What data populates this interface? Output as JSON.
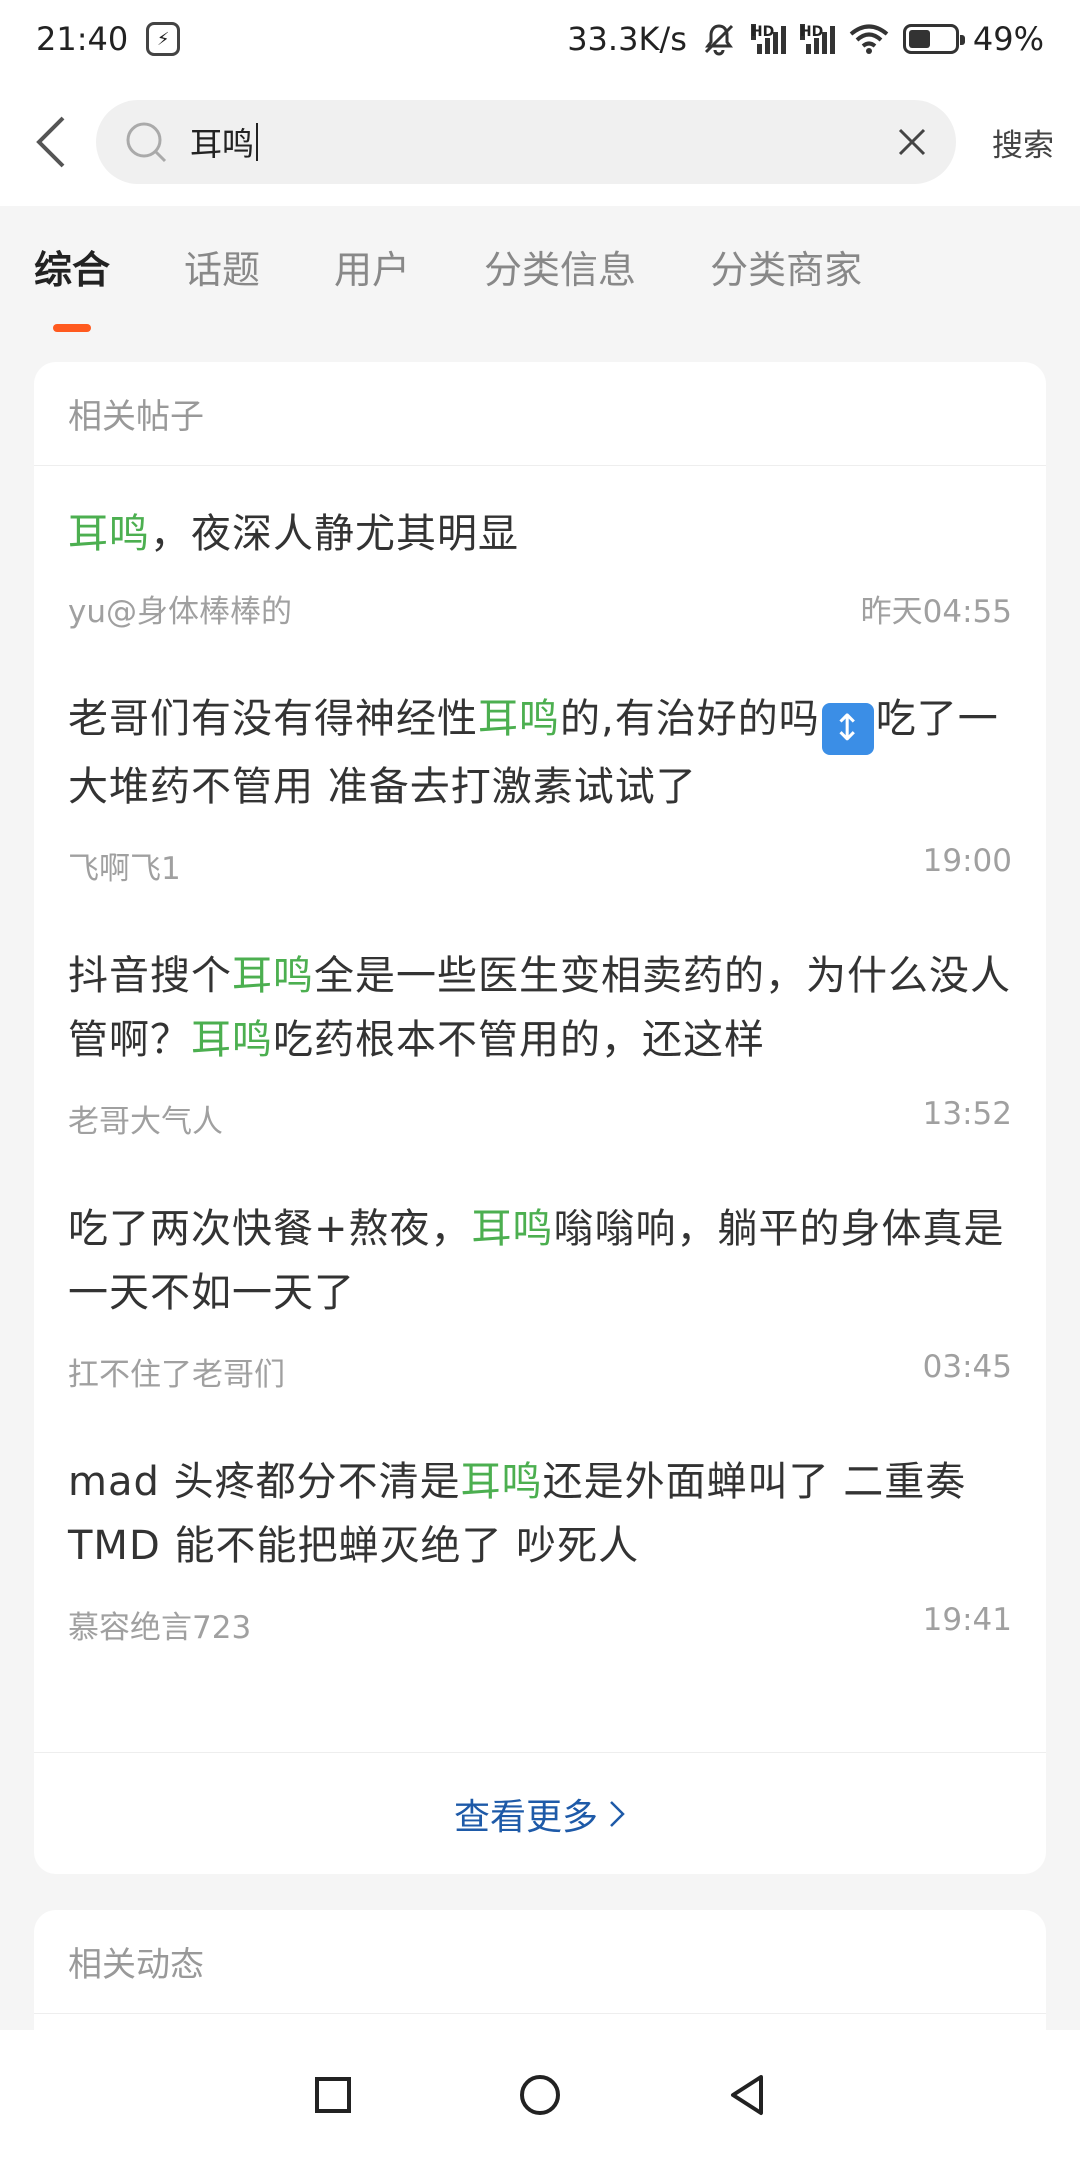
{
  "status_bar": {
    "time": "21:40",
    "network_speed": "33.3K/s",
    "battery_percent": "49%",
    "icons": [
      "shield-icon",
      "mute-icon",
      "hd-signal-icon",
      "hd-signal-icon",
      "wifi-icon",
      "battery-icon"
    ]
  },
  "search": {
    "query": "耳鸣",
    "action_label": "搜索"
  },
  "tabs": [
    {
      "label": "综合",
      "active": true
    },
    {
      "label": "话题",
      "active": false
    },
    {
      "label": "用户",
      "active": false
    },
    {
      "label": "分类信息",
      "active": false
    },
    {
      "label": "分类商家",
      "active": false
    }
  ],
  "posts_section": {
    "title": "相关帖子",
    "posts": [
      {
        "title_parts": [
          "耳鸣",
          "，夜深人静尤其明显"
        ],
        "author": "yu@身体棒棒的",
        "time": "昨天04:55"
      },
      {
        "title_parts": [
          "老哥们有没有得神经性",
          "耳鸣",
          "的,有治好的吗",
          "↕",
          "吃了一大堆药不管用 准备去打激素试试了"
        ],
        "author": "飞啊飞1",
        "time": "19:00"
      },
      {
        "title_parts": [
          "抖音搜个",
          "耳鸣",
          "全是一些医生变相卖药的，为什么没人管啊？",
          "耳鸣",
          "吃药根本不管用的，还这样"
        ],
        "author": "老哥大气人",
        "time": "13:52"
      },
      {
        "title_parts": [
          "吃了两次快餐+熬夜，",
          "耳鸣",
          "嗡嗡响，躺平的身体真是一天不如一天了"
        ],
        "author": "扛不住了老哥们",
        "time": "03:45"
      },
      {
        "title_parts": [
          "mad 头疼都分不清是",
          "耳鸣",
          "还是外面蝉叫了 二重奏 TMD 能不能把蝉灭绝了 吵死人"
        ],
        "author": "慕容绝言723",
        "time": "19:41"
      }
    ],
    "more_label": "查看更多"
  },
  "dynamics_section": {
    "title": "相关动态"
  },
  "colors": {
    "highlight": "#4caf50",
    "tab_indicator": "#ff5a1f",
    "link": "#1e5aa8"
  }
}
